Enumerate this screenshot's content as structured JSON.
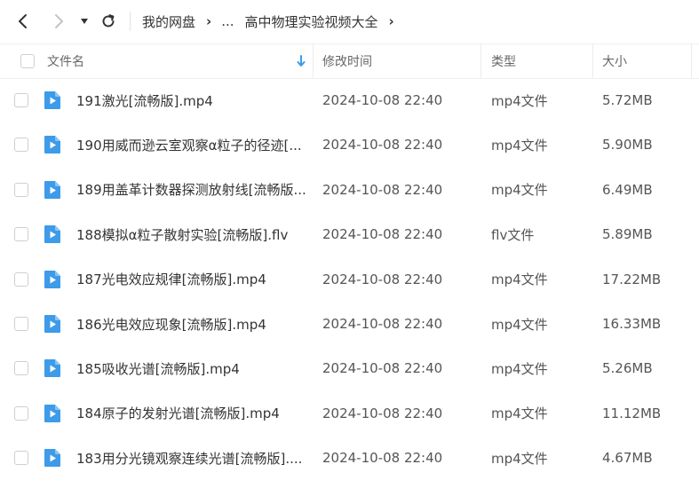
{
  "breadcrumb": {
    "root": "我的网盘",
    "ellipsis": "...",
    "current": "高中物理实验视频大全"
  },
  "columns": {
    "name": "文件名",
    "modified": "修改时间",
    "type": "类型",
    "size": "大小"
  },
  "colors": {
    "icon_blue": "#3d9be9",
    "sort_arrow": "#3d9be9"
  },
  "files": [
    {
      "name": "191激光[流畅版].mp4",
      "modified": "2024-10-08 22:40",
      "type": "mp4文件",
      "size": "5.72MB"
    },
    {
      "name": "190用威而逊云室观察α粒子的径迹[...",
      "modified": "2024-10-08 22:40",
      "type": "mp4文件",
      "size": "5.90MB"
    },
    {
      "name": "189用盖革计数器探测放射线[流畅版...",
      "modified": "2024-10-08 22:40",
      "type": "mp4文件",
      "size": "6.49MB"
    },
    {
      "name": "188模拟α粒子散射实验[流畅版].flv",
      "modified": "2024-10-08 22:40",
      "type": "flv文件",
      "size": "5.89MB"
    },
    {
      "name": "187光电效应规律[流畅版].mp4",
      "modified": "2024-10-08 22:40",
      "type": "mp4文件",
      "size": "17.22MB"
    },
    {
      "name": "186光电效应现象[流畅版].mp4",
      "modified": "2024-10-08 22:40",
      "type": "mp4文件",
      "size": "16.33MB"
    },
    {
      "name": "185吸收光谱[流畅版].mp4",
      "modified": "2024-10-08 22:40",
      "type": "mp4文件",
      "size": "5.26MB"
    },
    {
      "name": "184原子的发射光谱[流畅版].mp4",
      "modified": "2024-10-08 22:40",
      "type": "mp4文件",
      "size": "11.12MB"
    },
    {
      "name": "183用分光镜观察连续光谱[流畅版]....",
      "modified": "2024-10-08 22:40",
      "type": "mp4文件",
      "size": "4.67MB"
    }
  ]
}
